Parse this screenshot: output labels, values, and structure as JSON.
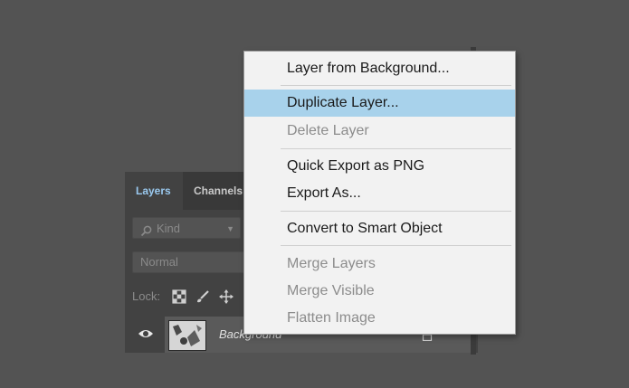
{
  "layers_panel": {
    "tabs": [
      {
        "label": "Layers",
        "active": true
      },
      {
        "label": "Channels",
        "active": false
      }
    ],
    "filter": {
      "icon": "search-icon",
      "label": "Kind"
    },
    "blend_mode": "Normal",
    "lock_label": "Lock:",
    "layer": {
      "name": "Background",
      "visible": true,
      "locked": true
    }
  },
  "context_menu": {
    "items": [
      {
        "label": "Layer from Background...",
        "enabled": true
      },
      {
        "label": "Duplicate Layer...",
        "enabled": true,
        "highlighted": true
      },
      {
        "label": "Delete Layer",
        "enabled": false
      },
      {
        "label": "Quick Export as PNG",
        "enabled": true
      },
      {
        "label": "Export As...",
        "enabled": true
      },
      {
        "label": "Convert to Smart Object",
        "enabled": true
      },
      {
        "label": "Merge Layers",
        "enabled": false
      },
      {
        "label": "Merge Visible",
        "enabled": false
      },
      {
        "label": "Flatten Image",
        "enabled": false
      }
    ]
  },
  "colors": {
    "highlight": "#a8d2eb",
    "menu_bg": "#f2f2f2",
    "active_tab_text": "#9ac9ef",
    "app_bg": "#535353"
  }
}
